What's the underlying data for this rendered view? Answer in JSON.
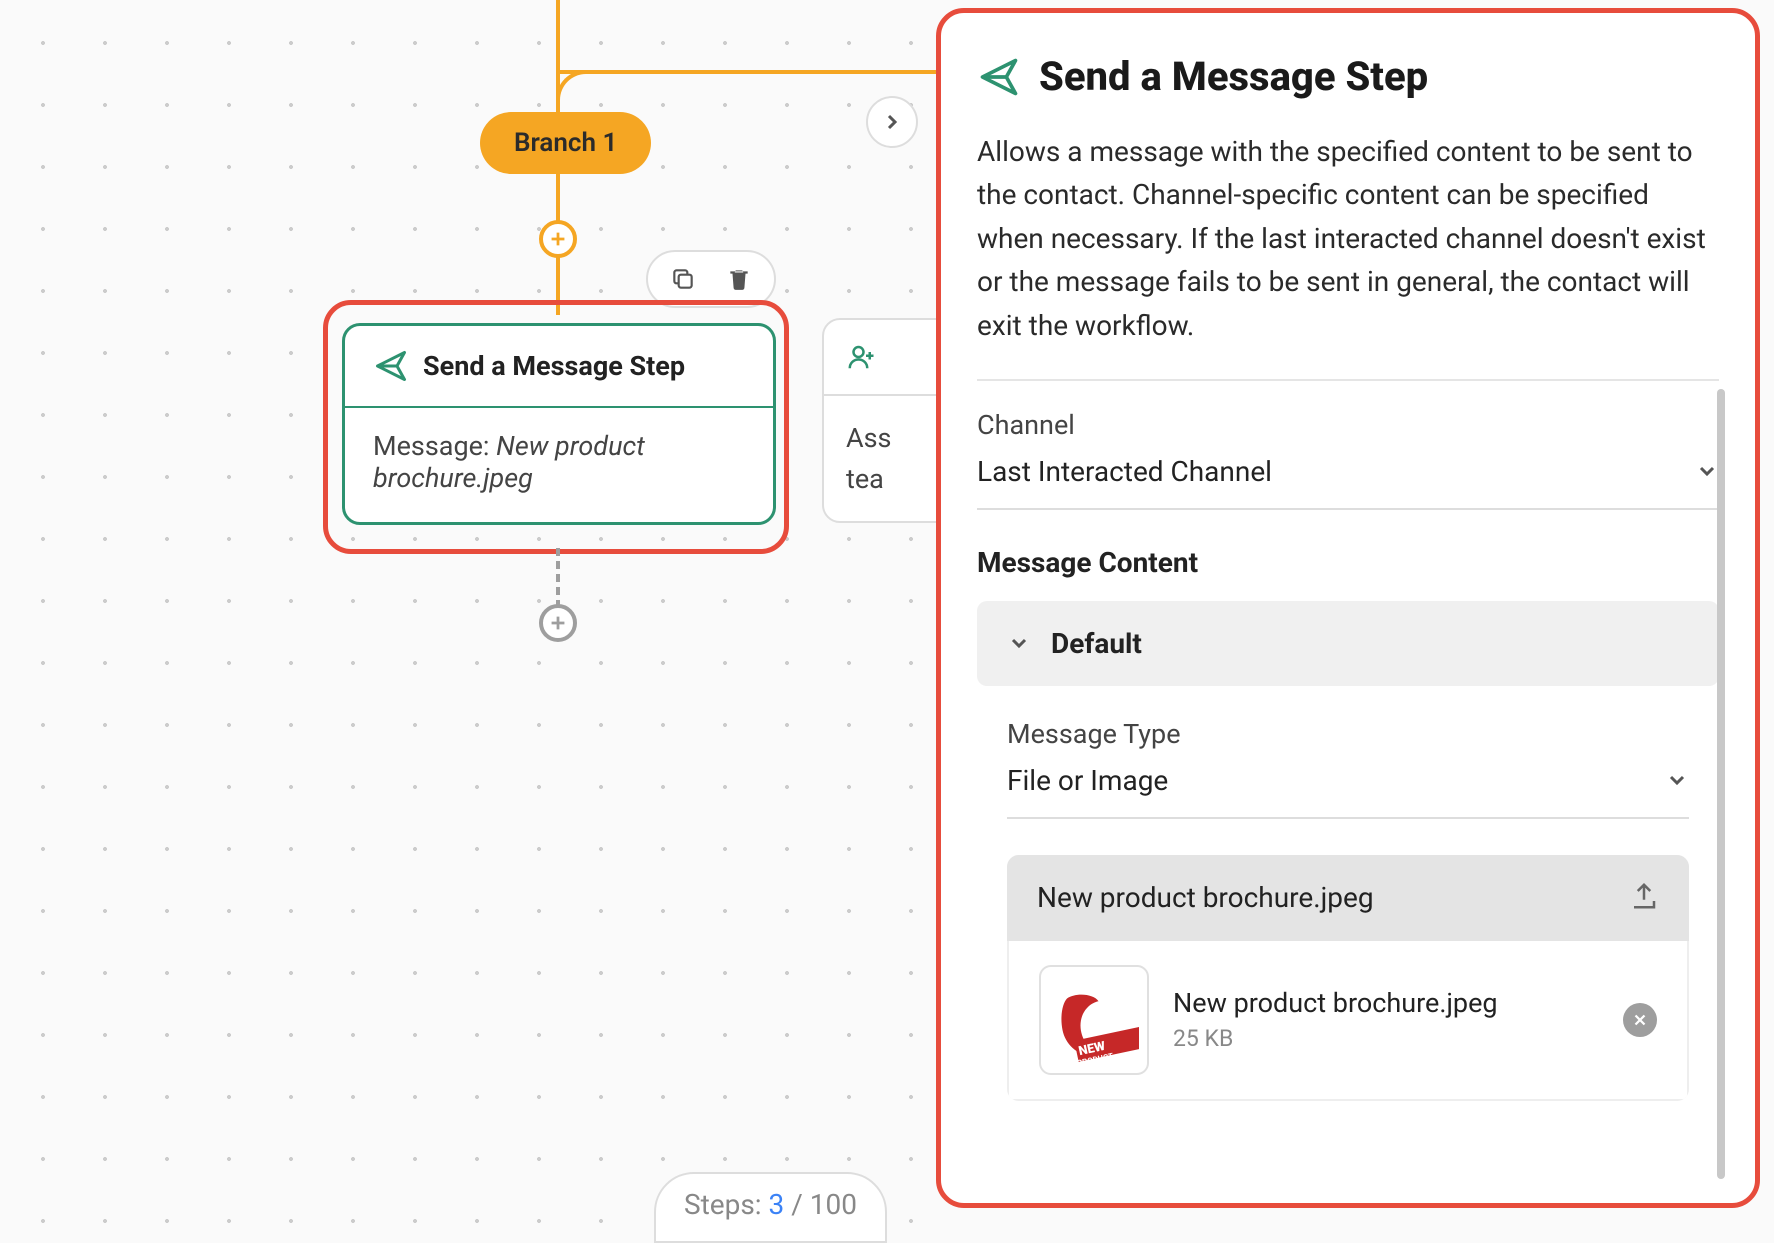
{
  "canvas": {
    "branch_label": "Branch 1",
    "node": {
      "title": "Send a Message Step",
      "body_label": "Message: ",
      "body_value": "New product brochure.jpeg"
    },
    "adjacent": {
      "line1": "Ass",
      "line2": "tea"
    },
    "steps": {
      "label": "Steps: ",
      "current": "3",
      "sep": " / ",
      "total": "100"
    }
  },
  "panel": {
    "title": "Send a Message Step",
    "description": "Allows a message with the specified content to be sent to the contact. Channel-specific content can be specified when necessary. If the last interacted channel doesn't exist or the message fails to be sent in general, the contact will exit the workflow.",
    "channel": {
      "label": "Channel",
      "value": "Last Interacted Channel"
    },
    "message_content_label": "Message Content",
    "accordion_label": "Default",
    "message_type": {
      "label": "Message Type",
      "value": "File or Image"
    },
    "file": {
      "display_name": "New product brochure.jpeg",
      "name": "New product brochure.jpeg",
      "size": "25 KB"
    }
  }
}
